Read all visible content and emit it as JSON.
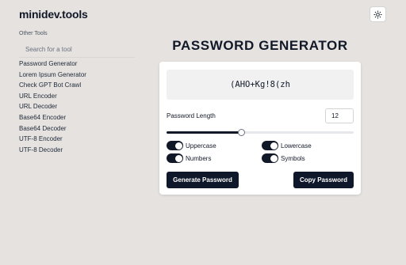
{
  "brand": "minidev.tools",
  "theme_icon": "sun-icon",
  "sidebar": {
    "heading": "Other Tools",
    "search_placeholder": "Search for a tool",
    "items": [
      {
        "label": "Password Generator"
      },
      {
        "label": "Lorem Ipsum Generator"
      },
      {
        "label": "Check GPT Bot Crawl"
      },
      {
        "label": "URL Encoder"
      },
      {
        "label": "URL Decoder"
      },
      {
        "label": "Base64 Encoder"
      },
      {
        "label": "Base64 Decoder"
      },
      {
        "label": "UTF-8 Encoder"
      },
      {
        "label": "UTF-8 Decoder"
      }
    ]
  },
  "main": {
    "title": "PASSWORD GENERATOR",
    "password": "(AHO+Kg!8(zh",
    "length_label": "Password Length",
    "length_value": "12",
    "slider_fraction": 0.4,
    "options": {
      "uppercase": {
        "label": "Uppercase",
        "checked": true
      },
      "lowercase": {
        "label": "Lowercase",
        "checked": true
      },
      "numbers": {
        "label": "Numbers",
        "checked": true
      },
      "symbols": {
        "label": "Symbols",
        "checked": true
      }
    },
    "generate_label": "Generate Password",
    "copy_label": "Copy Password"
  },
  "colors": {
    "background": "#e5e2e0",
    "card": "#ffffff",
    "primary": "#0f172a"
  }
}
